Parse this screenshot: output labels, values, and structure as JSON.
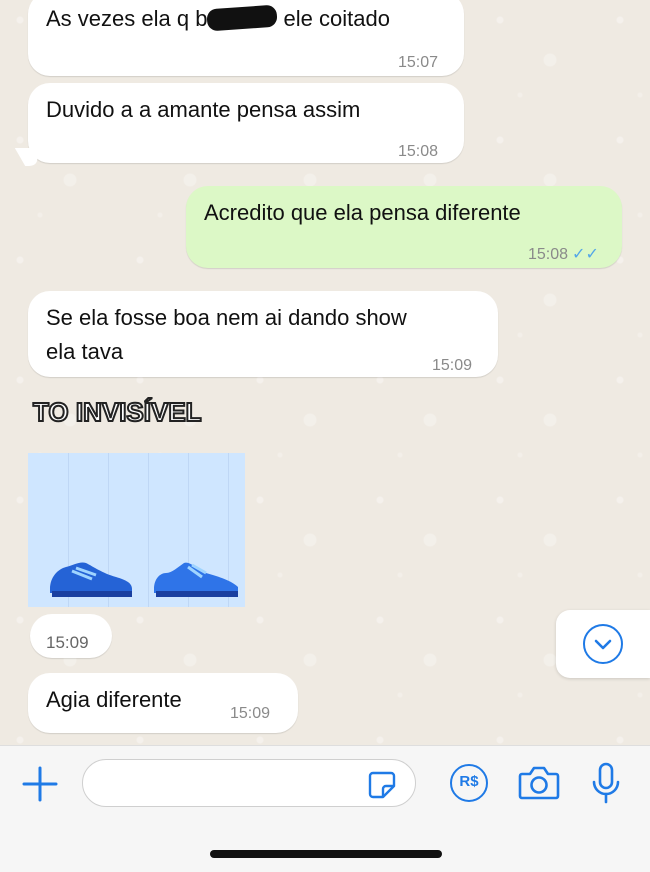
{
  "messages": [
    {
      "direction": "in",
      "text_before": "As vezes ela q b",
      "text_after": " ele coitado",
      "time": "15:07"
    },
    {
      "direction": "in",
      "text": "Duvido a a amante pensa assim",
      "time": "15:08"
    },
    {
      "direction": "out",
      "text": "Acredito que ela pensa diferente",
      "time": "15:08",
      "status": "read"
    },
    {
      "direction": "in",
      "line1": "Se ela fosse boa nem ai dando show",
      "line2": "ela tava",
      "time": "15:09"
    },
    {
      "direction": "in",
      "type": "sticker",
      "sticker_text": "TO INVISÍVEL",
      "time": "15:09"
    },
    {
      "direction": "in",
      "text": "Agia diferente",
      "time": "15:09"
    }
  ],
  "colors": {
    "accent": "#1f7ae6",
    "outgoing_bubble": "#dcf8c6",
    "incoming_bubble": "#ffffff",
    "read_ticks": "#53a6e8",
    "chat_background": "#efeae2"
  },
  "icons": {
    "plus": "plus-icon",
    "sticker": "sticker-icon",
    "payment": "payment-icon",
    "camera": "camera-icon",
    "mic": "microphone-icon",
    "scroll": "chevron-down-icon"
  },
  "composer": {
    "placeholder": ""
  },
  "payment_label": "R$"
}
